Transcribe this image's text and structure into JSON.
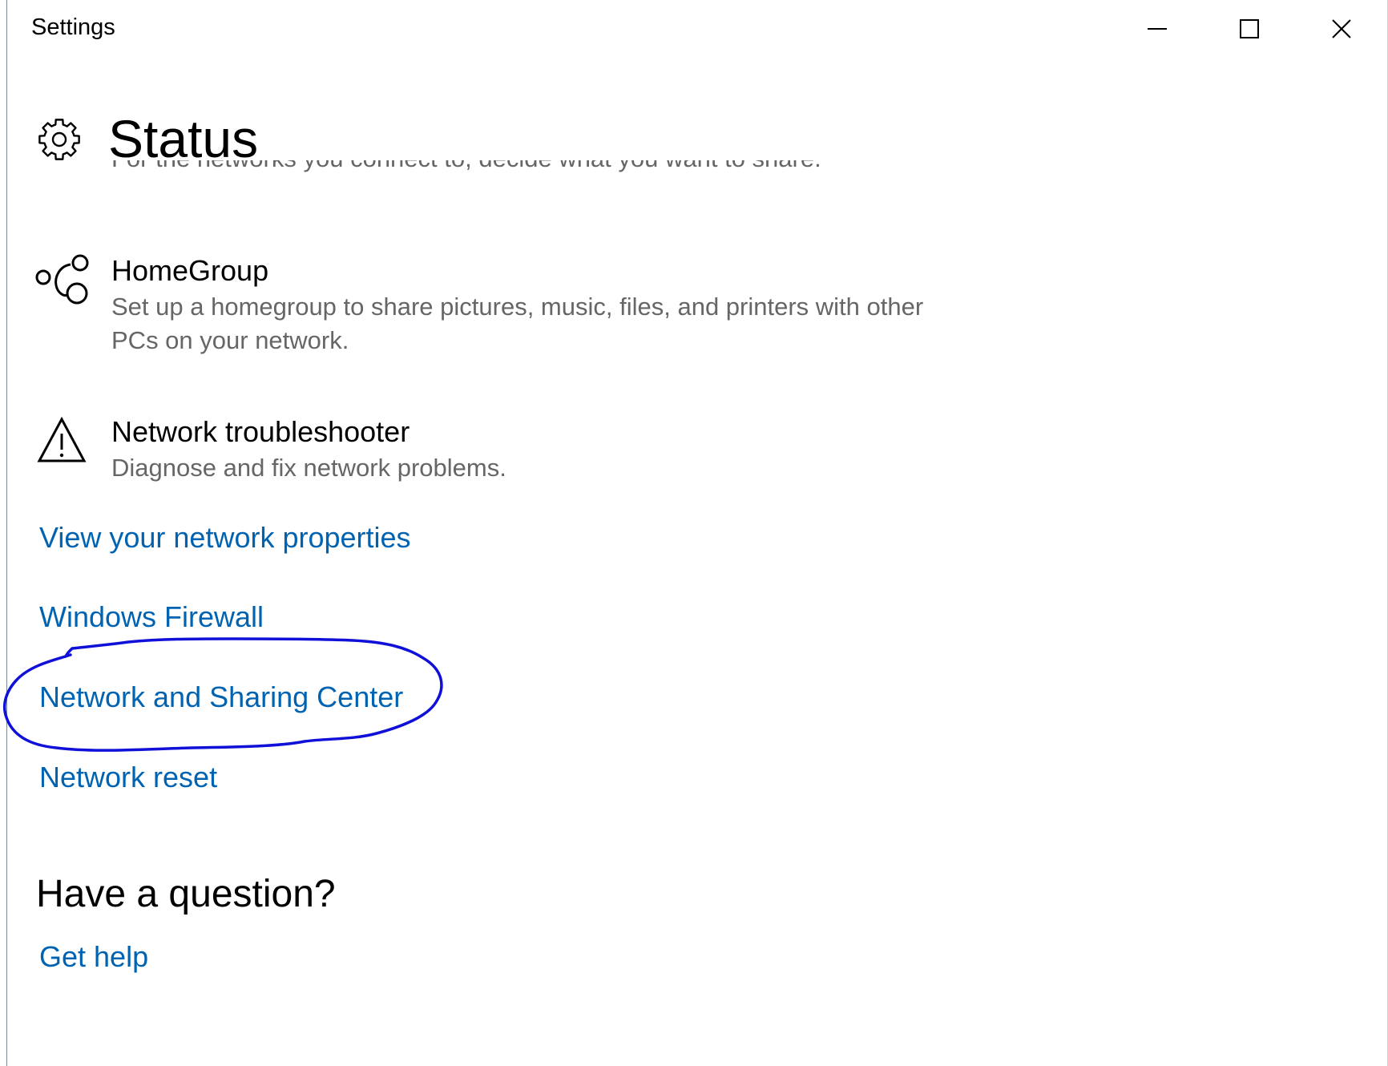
{
  "window": {
    "title": "Settings",
    "controls": {
      "minimize": "minimize-icon",
      "maximize": "maximize-icon",
      "close": "close-icon"
    }
  },
  "header": {
    "icon": "gear-icon",
    "title": "Status"
  },
  "clipped_line": "For the networks you connect to, decide what you want to share.",
  "items": [
    {
      "icon": "homegroup-icon",
      "title": "HomeGroup",
      "description": "Set up a homegroup to share pictures, music, files, and printers with other PCs on your network."
    },
    {
      "icon": "warning-icon",
      "title": "Network troubleshooter",
      "description": "Diagnose and fix network problems."
    }
  ],
  "links": [
    "View your network properties",
    "Windows Firewall",
    "Network and Sharing Center",
    "Network reset"
  ],
  "help": {
    "heading": "Have a question?",
    "link": "Get help"
  },
  "colors": {
    "link": "#0063b1",
    "description": "#666666",
    "annotation": "#1010d8"
  }
}
